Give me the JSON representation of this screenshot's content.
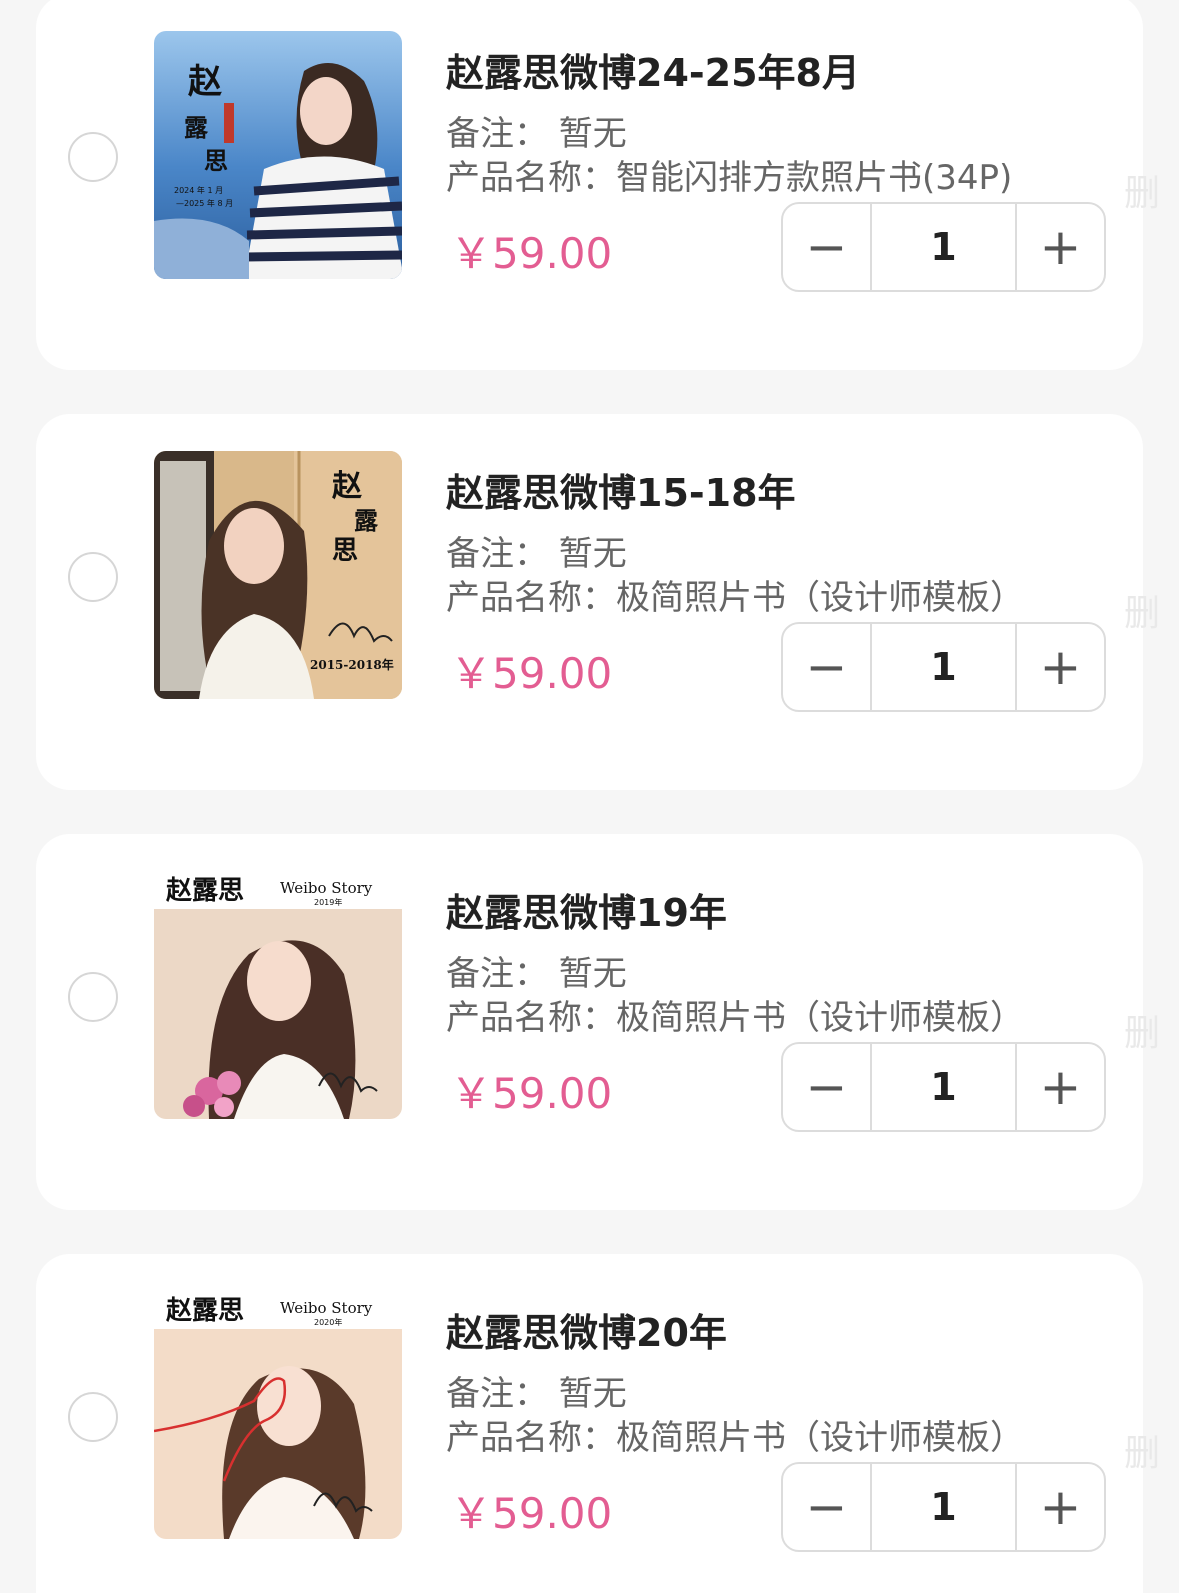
{
  "cart": {
    "items": [
      {
        "title": "赵露思微博24-25年8月",
        "remark": "备注：  暂无",
        "product": "产品名称：智能闪排方款照片书(34P)",
        "price": "￥59.00",
        "quantity": "1",
        "minus": "−",
        "plus": "+",
        "delete_hint": "删",
        "cover_text": [
          "赵",
          "露",
          "思",
          "2024 年 1 月",
          "—2025 年 8 月"
        ]
      },
      {
        "title": "赵露思微博15-18年",
        "remark": "备注：  暂无",
        "product": "产品名称：极简照片书（设计师模板）",
        "price": "￥59.00",
        "quantity": "1",
        "minus": "−",
        "plus": "+",
        "delete_hint": "删",
        "cover_text": [
          "赵",
          "露",
          "思",
          "2015-2018年"
        ]
      },
      {
        "title": "赵露思微博19年",
        "remark": "备注：  暂无",
        "product": "产品名称：极简照片书（设计师模板）",
        "price": "￥59.00",
        "quantity": "1",
        "minus": "−",
        "plus": "+",
        "delete_hint": "删",
        "cover_text": [
          "赵露思",
          "Weibo Story",
          "2019年"
        ]
      },
      {
        "title": "赵露思微博20年",
        "remark": "备注：  暂无",
        "product": "产品名称：极简照片书（设计师模板）",
        "price": "￥59.00",
        "quantity": "1",
        "minus": "−",
        "plus": "+",
        "delete_hint": "删",
        "cover_text": [
          "赵露思",
          "Weibo Story",
          "2020年"
        ]
      }
    ]
  },
  "colors": {
    "price": "#e35d92",
    "background": "#f6f6f6",
    "card": "#ffffff"
  }
}
